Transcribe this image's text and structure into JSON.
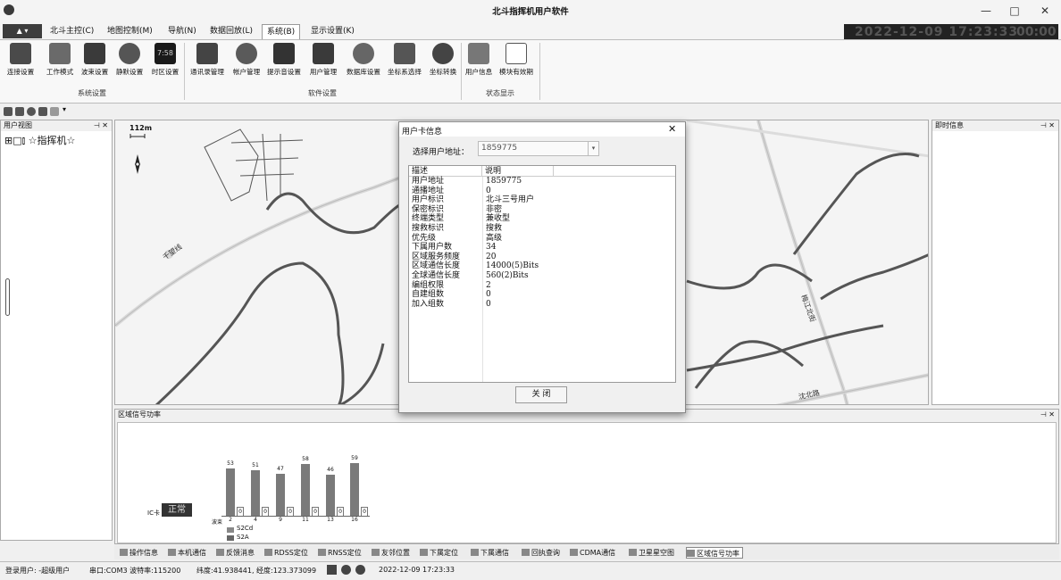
{
  "window": {
    "title": "北斗指挥机用户软件",
    "minimize": "—",
    "maximize": "□",
    "close": "✕"
  },
  "menu": {
    "app_button": "▲ ▾",
    "items": [
      "北斗主控(C)",
      "地图控制(M)",
      "导航(N)",
      "数据回放(L)",
      "系统(B)",
      "显示设置(K)"
    ],
    "active": "系统(B)"
  },
  "clock": {
    "date_time": "2022-12-09 17:23:33",
    "seconds": "00:00"
  },
  "ribbon": {
    "buttons": [
      "连接设置",
      "工作模式",
      "波束设置",
      "静默设置",
      "时区设置",
      "通讯录管理",
      "帐户管理",
      "提示音设置",
      "用户管理",
      "数据库设置",
      "坐标系选择",
      "坐标转换",
      "用户信息",
      "模块有效期"
    ],
    "groups": [
      "系统设置",
      "软件设置",
      "状态显示"
    ],
    "time_icon_text": "7:58"
  },
  "qat": {
    "dropdown": "▾"
  },
  "left_pane": {
    "title": "用户视图",
    "pin": "⊣ ✕",
    "tree_root": "⊞□⫾ ☆指挥机☆"
  },
  "right_pane": {
    "title": "即时信息",
    "pin": "⊣ ✕"
  },
  "map": {
    "scale_label": "112m",
    "road_labels": [
      "千望线",
      "梅江北街",
      "沈北路"
    ],
    "north_arrow": "↕"
  },
  "dialog": {
    "title": "用户卡信息",
    "close": "✕",
    "address_label": "选择用户地址：",
    "address_value": "1859775",
    "columns": [
      "描述",
      "说明"
    ],
    "rows": [
      [
        "用户地址",
        "1859775"
      ],
      [
        "通播地址",
        "0"
      ],
      [
        "用户标识",
        "北斗三号用户"
      ],
      [
        "保密标识",
        "非密"
      ],
      [
        "终端类型",
        "兼收型"
      ],
      [
        "搜救标识",
        "搜救"
      ],
      [
        "优先级",
        "高级"
      ],
      [
        "下属用户数",
        "34"
      ],
      [
        "区域服务频度",
        "20"
      ],
      [
        "区域通信长度",
        "14000(5)Bits"
      ],
      [
        "全球通信长度",
        "560(2)Bits"
      ],
      [
        "编组权限",
        "2"
      ],
      [
        "自建组数",
        "0"
      ],
      [
        "加入组数",
        "0"
      ]
    ],
    "close_button": "关  闭"
  },
  "signal_pane": {
    "title": "区域信号功率",
    "pin": "⊣ ✕",
    "ic_label": "IC卡",
    "ic_status": "正常",
    "beam_label": "波束",
    "legend": [
      "S2Cd",
      "S2A"
    ]
  },
  "chart_data": {
    "type": "bar",
    "categories": [
      "2",
      "4",
      "9",
      "11",
      "13",
      "16"
    ],
    "series": [
      {
        "name": "S2Cd",
        "values": [
          53,
          51,
          47,
          58,
          46,
          59
        ]
      },
      {
        "name": "S2A",
        "values": [
          0,
          0,
          0,
          0,
          0,
          0
        ]
      }
    ],
    "xlabel": "波束",
    "ylim": [
      0,
      60
    ]
  },
  "tabs": [
    "操作信息",
    "本机通信",
    "反馈消息",
    "RDSS定位",
    "RNSS定位",
    "友邻位置",
    "下属定位",
    "下属通信",
    "回执查询",
    "CDMA通信",
    "卫星星空图",
    "区域信号功率"
  ],
  "statusbar": {
    "user": "登录用户: -超级用户",
    "port": "串口:COM3 波特率:115200",
    "coords": "纬度:41.938441, 经度:123.373099",
    "datetime": "2022-12-09 17:23:33"
  }
}
